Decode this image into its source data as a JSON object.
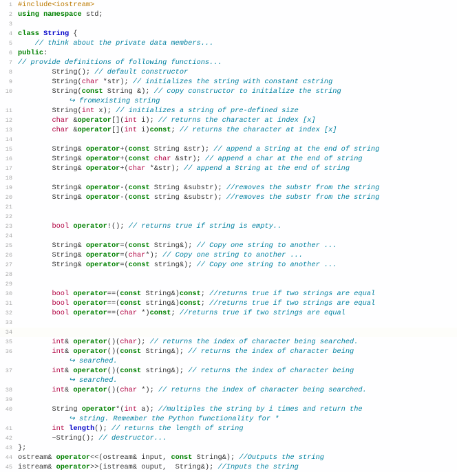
{
  "source_code": {
    "lines": [
      {
        "n": 1,
        "indent": 0,
        "seg": [
          [
            "pp",
            "#include"
          ],
          [
            "pp",
            "<iostream>"
          ]
        ]
      },
      {
        "n": 2,
        "indent": 0,
        "seg": [
          [
            "kw",
            "using"
          ],
          [
            "nm",
            " "
          ],
          [
            "kw",
            "namespace"
          ],
          [
            "nm",
            " std;"
          ]
        ]
      },
      {
        "n": 3,
        "indent": 0,
        "seg": []
      },
      {
        "n": 4,
        "indent": 0,
        "seg": [
          [
            "kw",
            "class"
          ],
          [
            "nm",
            " "
          ],
          [
            "cls",
            "String"
          ],
          [
            "nm",
            " {"
          ]
        ]
      },
      {
        "n": 5,
        "indent": 1,
        "seg": [
          [
            "cm",
            "// think about the private data members..."
          ]
        ]
      },
      {
        "n": 6,
        "indent": 0,
        "seg": [
          [
            "kw",
            "public"
          ],
          [
            "nm",
            ":"
          ]
        ]
      },
      {
        "n": 7,
        "indent": 0,
        "seg": [
          [
            "cm",
            "// provide definitions of following functions..."
          ]
        ]
      },
      {
        "n": 8,
        "indent": 2,
        "seg": [
          [
            "nm",
            "String(); "
          ],
          [
            "cm",
            "// default constructor"
          ]
        ]
      },
      {
        "n": 9,
        "indent": 2,
        "seg": [
          [
            "nm",
            "String("
          ],
          [
            "tp",
            "char"
          ],
          [
            "nm",
            " *str); "
          ],
          [
            "cm",
            "// initializes the string with constant cstring"
          ]
        ]
      },
      {
        "n": 10,
        "indent": 2,
        "seg": [
          [
            "nm",
            "String("
          ],
          [
            "kw",
            "const"
          ],
          [
            "nm",
            " String &); "
          ],
          [
            "cm",
            "// copy constructor to initialize the string"
          ]
        ],
        "wrap": [
          [
            "cm",
            "fromexisting string"
          ]
        ]
      },
      {
        "n": 11,
        "indent": 2,
        "seg": [
          [
            "nm",
            "String("
          ],
          [
            "tp",
            "int"
          ],
          [
            "nm",
            " x); "
          ],
          [
            "cm",
            "// initializes a string of pre-defined size"
          ]
        ]
      },
      {
        "n": 12,
        "indent": 2,
        "seg": [
          [
            "tp",
            "char"
          ],
          [
            "nm",
            " &"
          ],
          [
            "kw",
            "operator"
          ],
          [
            "nm",
            "[]("
          ],
          [
            "tp",
            "int"
          ],
          [
            "nm",
            " i); "
          ],
          [
            "cm",
            "// returns the character at index [x]"
          ]
        ]
      },
      {
        "n": 13,
        "indent": 2,
        "seg": [
          [
            "tp",
            "char"
          ],
          [
            "nm",
            " &"
          ],
          [
            "kw",
            "operator"
          ],
          [
            "nm",
            "[]("
          ],
          [
            "tp",
            "int"
          ],
          [
            "nm",
            " i)"
          ],
          [
            "kw",
            "const"
          ],
          [
            "nm",
            "; "
          ],
          [
            "cm",
            "// returns the character at index [x]"
          ]
        ]
      },
      {
        "n": 14,
        "indent": 0,
        "seg": []
      },
      {
        "n": 15,
        "indent": 2,
        "seg": [
          [
            "nm",
            "String& "
          ],
          [
            "kw",
            "operator"
          ],
          [
            "nm",
            "+("
          ],
          [
            "kw",
            "const"
          ],
          [
            "nm",
            " String &str); "
          ],
          [
            "cm",
            "// append a String at the end of string"
          ]
        ]
      },
      {
        "n": 16,
        "indent": 2,
        "seg": [
          [
            "nm",
            "String& "
          ],
          [
            "kw",
            "operator"
          ],
          [
            "nm",
            "+("
          ],
          [
            "kw",
            "const"
          ],
          [
            "nm",
            " "
          ],
          [
            "tp",
            "char"
          ],
          [
            "nm",
            " &str); "
          ],
          [
            "cm",
            "// append a char at the end of string"
          ]
        ]
      },
      {
        "n": 17,
        "indent": 2,
        "seg": [
          [
            "nm",
            "String& "
          ],
          [
            "kw",
            "operator"
          ],
          [
            "nm",
            "+("
          ],
          [
            "tp",
            "char"
          ],
          [
            "nm",
            " *&str); "
          ],
          [
            "cm",
            "// append a String at the end of string"
          ]
        ]
      },
      {
        "n": 18,
        "indent": 0,
        "seg": []
      },
      {
        "n": 19,
        "indent": 2,
        "seg": [
          [
            "nm",
            "String& "
          ],
          [
            "kw",
            "operator"
          ],
          [
            "nm",
            "-("
          ],
          [
            "kw",
            "const"
          ],
          [
            "nm",
            " String &substr); "
          ],
          [
            "cm",
            "//removes the substr from the string"
          ]
        ]
      },
      {
        "n": 20,
        "indent": 2,
        "seg": [
          [
            "nm",
            "String& "
          ],
          [
            "kw",
            "operator"
          ],
          [
            "nm",
            "-("
          ],
          [
            "kw",
            "const"
          ],
          [
            "nm",
            " string &substr); "
          ],
          [
            "cm",
            "//removes the substr from the string"
          ]
        ]
      },
      {
        "n": 21,
        "indent": 0,
        "seg": []
      },
      {
        "n": 22,
        "indent": 0,
        "seg": []
      },
      {
        "n": 23,
        "indent": 2,
        "seg": [
          [
            "tp",
            "bool"
          ],
          [
            "nm",
            " "
          ],
          [
            "kw",
            "operator"
          ],
          [
            "nm",
            "!(); "
          ],
          [
            "cm",
            "// returns true if string is empty.."
          ]
        ]
      },
      {
        "n": 24,
        "indent": 0,
        "seg": []
      },
      {
        "n": 25,
        "indent": 2,
        "seg": [
          [
            "nm",
            "String& "
          ],
          [
            "kw",
            "operator"
          ],
          [
            "nm",
            "=("
          ],
          [
            "kw",
            "const"
          ],
          [
            "nm",
            " String&); "
          ],
          [
            "cm",
            "// Copy one string to another ..."
          ]
        ]
      },
      {
        "n": 26,
        "indent": 2,
        "seg": [
          [
            "nm",
            "String& "
          ],
          [
            "kw",
            "operator"
          ],
          [
            "nm",
            "=("
          ],
          [
            "tp",
            "char"
          ],
          [
            "nm",
            "*); "
          ],
          [
            "cm",
            "// Copy one string to another ..."
          ]
        ]
      },
      {
        "n": 27,
        "indent": 2,
        "seg": [
          [
            "nm",
            "String& "
          ],
          [
            "kw",
            "operator"
          ],
          [
            "nm",
            "=("
          ],
          [
            "kw",
            "const"
          ],
          [
            "nm",
            " string&); "
          ],
          [
            "cm",
            "// Copy one string to another ..."
          ]
        ]
      },
      {
        "n": 28,
        "indent": 0,
        "seg": []
      },
      {
        "n": 29,
        "indent": 0,
        "seg": []
      },
      {
        "n": 30,
        "indent": 2,
        "seg": [
          [
            "tp",
            "bool"
          ],
          [
            "nm",
            " "
          ],
          [
            "kw",
            "operator"
          ],
          [
            "nm",
            "==("
          ],
          [
            "kw",
            "const"
          ],
          [
            "nm",
            " String&)"
          ],
          [
            "kw",
            "const"
          ],
          [
            "nm",
            "; "
          ],
          [
            "cm",
            "//returns true if two strings are equal"
          ]
        ]
      },
      {
        "n": 31,
        "indent": 2,
        "seg": [
          [
            "tp",
            "bool"
          ],
          [
            "nm",
            " "
          ],
          [
            "kw",
            "operator"
          ],
          [
            "nm",
            "==("
          ],
          [
            "kw",
            "const"
          ],
          [
            "nm",
            " string&)"
          ],
          [
            "kw",
            "const"
          ],
          [
            "nm",
            "; "
          ],
          [
            "cm",
            "//returns true if two strings are equal"
          ]
        ]
      },
      {
        "n": 32,
        "indent": 2,
        "seg": [
          [
            "tp",
            "bool"
          ],
          [
            "nm",
            " "
          ],
          [
            "kw",
            "operator"
          ],
          [
            "nm",
            "==("
          ],
          [
            "tp",
            "char"
          ],
          [
            "nm",
            " *)"
          ],
          [
            "kw",
            "const"
          ],
          [
            "nm",
            "; "
          ],
          [
            "cm",
            "//returns true if two strings are equal"
          ]
        ]
      },
      {
        "n": 33,
        "indent": 0,
        "seg": []
      },
      {
        "n": 34,
        "indent": 0,
        "seg": [],
        "sel": true
      },
      {
        "n": 35,
        "indent": 2,
        "seg": [
          [
            "tp",
            "int"
          ],
          [
            "nm",
            "& "
          ],
          [
            "kw",
            "operator"
          ],
          [
            "nm",
            "()("
          ],
          [
            "tp",
            "char"
          ],
          [
            "nm",
            "); "
          ],
          [
            "cm",
            "// returns the index of character being searched."
          ]
        ]
      },
      {
        "n": 36,
        "indent": 2,
        "seg": [
          [
            "tp",
            "int"
          ],
          [
            "nm",
            "& "
          ],
          [
            "kw",
            "operator"
          ],
          [
            "nm",
            "()("
          ],
          [
            "kw",
            "const"
          ],
          [
            "nm",
            " String&); "
          ],
          [
            "cm",
            "// returns the index of character being"
          ]
        ],
        "wrap": [
          [
            "cm",
            "searched."
          ]
        ]
      },
      {
        "n": 37,
        "indent": 2,
        "seg": [
          [
            "tp",
            "int"
          ],
          [
            "nm",
            "& "
          ],
          [
            "kw",
            "operator"
          ],
          [
            "nm",
            "()("
          ],
          [
            "kw",
            "const"
          ],
          [
            "nm",
            " string&); "
          ],
          [
            "cm",
            "// returns the index of character being"
          ]
        ],
        "wrap": [
          [
            "cm",
            "searched."
          ]
        ]
      },
      {
        "n": 38,
        "indent": 2,
        "seg": [
          [
            "tp",
            "int"
          ],
          [
            "nm",
            "& "
          ],
          [
            "kw",
            "operator"
          ],
          [
            "nm",
            "()("
          ],
          [
            "tp",
            "char"
          ],
          [
            "nm",
            " *); "
          ],
          [
            "cm",
            "// returns the index of character being searched."
          ]
        ]
      },
      {
        "n": 39,
        "indent": 0,
        "seg": []
      },
      {
        "n": 40,
        "indent": 2,
        "seg": [
          [
            "nm",
            "String "
          ],
          [
            "kw",
            "operator"
          ],
          [
            "nm",
            "*("
          ],
          [
            "tp",
            "int"
          ],
          [
            "nm",
            " a); "
          ],
          [
            "cm",
            "//multiples the string by i times and return the"
          ]
        ],
        "wrap": [
          [
            "cm",
            "string. Remember the Python functionality for *"
          ]
        ]
      },
      {
        "n": 41,
        "indent": 2,
        "seg": [
          [
            "tp",
            "int"
          ],
          [
            "nm",
            " "
          ],
          [
            "cls",
            "length"
          ],
          [
            "nm",
            "(); "
          ],
          [
            "cm",
            "// returns the length of string"
          ]
        ]
      },
      {
        "n": 42,
        "indent": 2,
        "seg": [
          [
            "nm",
            "~String(); "
          ],
          [
            "cm",
            "// destructor..."
          ]
        ]
      },
      {
        "n": 43,
        "indent": 0,
        "seg": [
          [
            "nm",
            "};"
          ]
        ]
      },
      {
        "n": 44,
        "indent": 0,
        "seg": [
          [
            "nm",
            "ostream& "
          ],
          [
            "kw",
            "operator"
          ],
          [
            "nm",
            "<<(ostream& input, "
          ],
          [
            "kw",
            "const"
          ],
          [
            "nm",
            " String&); "
          ],
          [
            "cm",
            "//Outputs the string"
          ]
        ]
      },
      {
        "n": 45,
        "indent": 0,
        "seg": [
          [
            "nm",
            "istream& "
          ],
          [
            "kw",
            "operator"
          ],
          [
            "nm",
            ">>(istream& ouput,  String&); "
          ],
          [
            "cm",
            "//Inputs the string"
          ]
        ]
      }
    ]
  }
}
